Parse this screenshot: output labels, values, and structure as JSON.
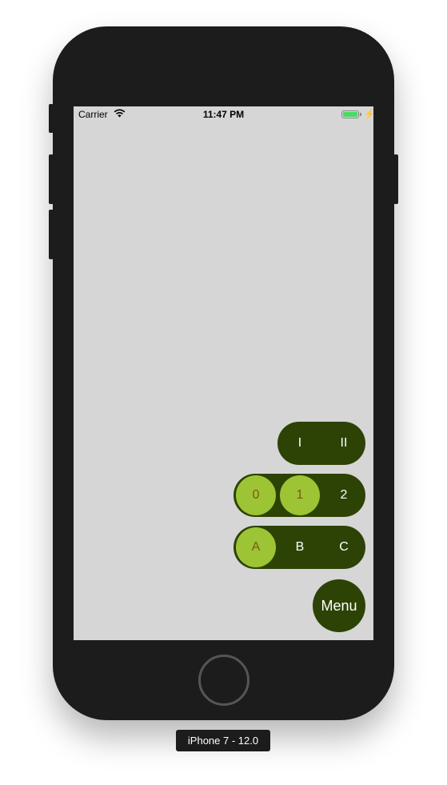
{
  "status_bar": {
    "carrier": "Carrier",
    "time": "11:47 PM"
  },
  "menus": {
    "roman": {
      "options": [
        "I",
        "II"
      ]
    },
    "numbers": {
      "options": [
        "0",
        "1",
        "2"
      ],
      "selected": [
        "0",
        "1"
      ]
    },
    "letters": {
      "options": [
        "A",
        "B",
        "C"
      ],
      "selected": [
        "A"
      ]
    }
  },
  "menu_button": {
    "label": "Menu"
  },
  "device_label": "iPhone 7 - 12.0",
  "colors": {
    "primary": "#2d4306",
    "selected": "#9dc434",
    "selected_text": "#7a5a10",
    "screen_bg": "#d6d6d6"
  }
}
